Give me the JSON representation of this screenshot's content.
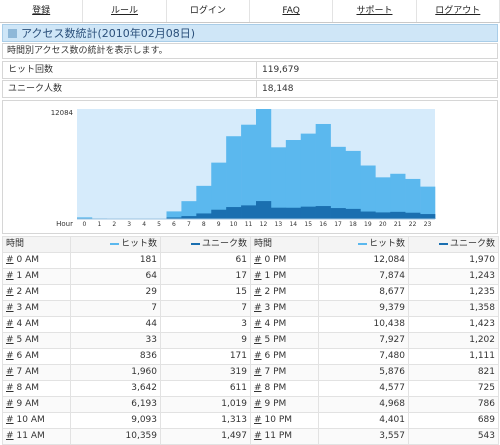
{
  "nav": [
    {
      "label": "登録",
      "underline": true
    },
    {
      "label": "ルール",
      "underline": true
    },
    {
      "label": "ログイン",
      "underline": false
    },
    {
      "label": "FAQ",
      "underline": true
    },
    {
      "label": "サポート",
      "underline": true
    },
    {
      "label": "ログアウト",
      "underline": true
    }
  ],
  "page": {
    "title": "アクセス数統計(2010年02月08日)",
    "description": "時間別アクセス数の統計を表示します。"
  },
  "stats": [
    {
      "label": "ヒット回数",
      "value": "119,679"
    },
    {
      "label": "ユニーク人数",
      "value": "18,148"
    }
  ],
  "colors": {
    "hits": "#5bb8ee",
    "unique": "#1a6fb0",
    "plot_bg": "#d6ebfb"
  },
  "chart_data": {
    "type": "bar",
    "categories": [
      "0",
      "1",
      "2",
      "3",
      "4",
      "5",
      "6",
      "7",
      "8",
      "9",
      "10",
      "11",
      "12",
      "13",
      "14",
      "15",
      "16",
      "17",
      "18",
      "19",
      "20",
      "21",
      "22",
      "23"
    ],
    "series": [
      {
        "values": [
          181,
          64,
          29,
          7,
          44,
          33,
          836,
          1960,
          3642,
          6193,
          9093,
          10359,
          12084,
          7874,
          8677,
          9379,
          10438,
          7927,
          7480,
          5876,
          4577,
          4968,
          4401,
          3557
        ]
      },
      {
        "values": [
          61,
          17,
          15,
          7,
          3,
          9,
          171,
          319,
          611,
          1019,
          1313,
          1497,
          1970,
          1243,
          1235,
          1358,
          1423,
          1202,
          1111,
          821,
          725,
          786,
          689,
          543
        ]
      }
    ],
    "ymax_label": "12084",
    "xlabel": "Hour",
    "ylim": [
      0,
      12084
    ]
  },
  "table": {
    "headers": {
      "time": "時間",
      "hits": "ヒット数",
      "unique": "ユニーク数"
    },
    "left": [
      {
        "hash": "#",
        "label": "0 AM",
        "hits": "181",
        "unique": "61"
      },
      {
        "hash": "#",
        "label": "1 AM",
        "hits": "64",
        "unique": "17"
      },
      {
        "hash": "#",
        "label": "2 AM",
        "hits": "29",
        "unique": "15"
      },
      {
        "hash": "#",
        "label": "3 AM",
        "hits": "7",
        "unique": "7"
      },
      {
        "hash": "#",
        "label": "4 AM",
        "hits": "44",
        "unique": "3"
      },
      {
        "hash": "#",
        "label": "5 AM",
        "hits": "33",
        "unique": "9"
      },
      {
        "hash": "#",
        "label": "6 AM",
        "hits": "836",
        "unique": "171"
      },
      {
        "hash": "#",
        "label": "7 AM",
        "hits": "1,960",
        "unique": "319"
      },
      {
        "hash": "#",
        "label": "8 AM",
        "hits": "3,642",
        "unique": "611"
      },
      {
        "hash": "#",
        "label": "9 AM",
        "hits": "6,193",
        "unique": "1,019"
      },
      {
        "hash": "#",
        "label": "10 AM",
        "hits": "9,093",
        "unique": "1,313"
      },
      {
        "hash": "#",
        "label": "11 AM",
        "hits": "10,359",
        "unique": "1,497"
      }
    ],
    "right": [
      {
        "hash": "#",
        "label": "0 PM",
        "hits": "12,084",
        "unique": "1,970"
      },
      {
        "hash": "#",
        "label": "1 PM",
        "hits": "7,874",
        "unique": "1,243"
      },
      {
        "hash": "#",
        "label": "2 PM",
        "hits": "8,677",
        "unique": "1,235"
      },
      {
        "hash": "#",
        "label": "3 PM",
        "hits": "9,379",
        "unique": "1,358"
      },
      {
        "hash": "#",
        "label": "4 PM",
        "hits": "10,438",
        "unique": "1,423"
      },
      {
        "hash": "#",
        "label": "5 PM",
        "hits": "7,927",
        "unique": "1,202"
      },
      {
        "hash": "#",
        "label": "6 PM",
        "hits": "7,480",
        "unique": "1,111"
      },
      {
        "hash": "#",
        "label": "7 PM",
        "hits": "5,876",
        "unique": "821"
      },
      {
        "hash": "#",
        "label": "8 PM",
        "hits": "4,577",
        "unique": "725"
      },
      {
        "hash": "#",
        "label": "9 PM",
        "hits": "4,968",
        "unique": "786"
      },
      {
        "hash": "#",
        "label": "10 PM",
        "hits": "4,401",
        "unique": "689"
      },
      {
        "hash": "#",
        "label": "11 PM",
        "hits": "3,557",
        "unique": "543"
      }
    ]
  }
}
